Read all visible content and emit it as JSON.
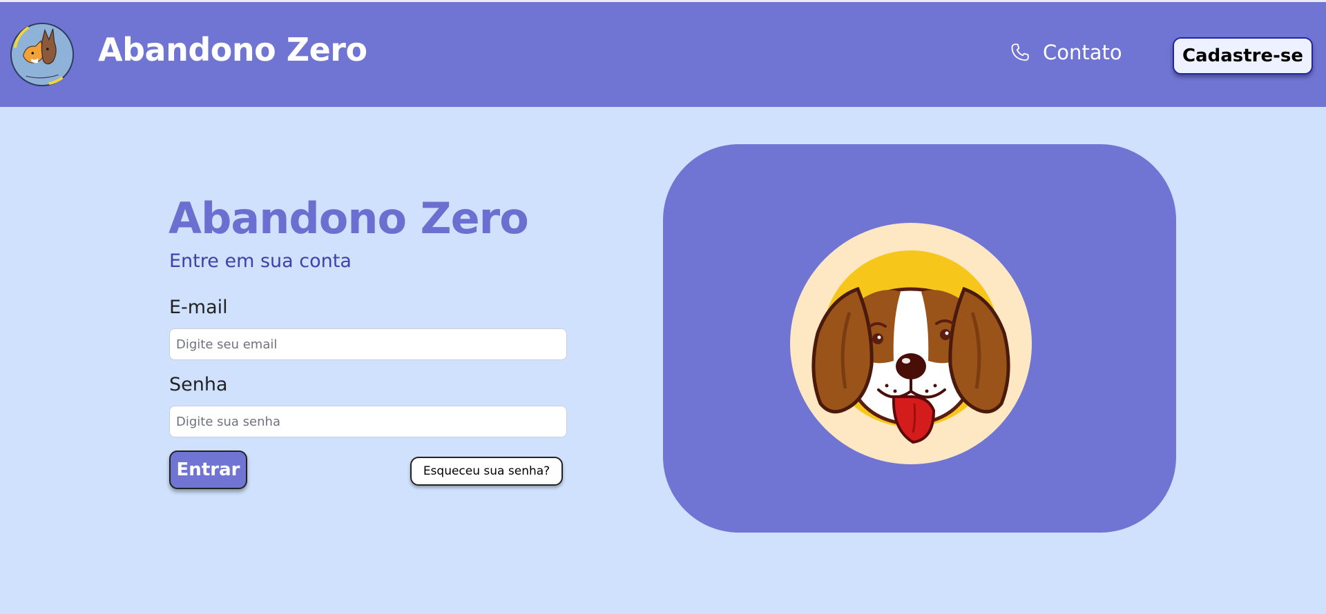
{
  "header": {
    "brand": "Abandono Zero",
    "logo_icon": "project-logo-icon",
    "contact": {
      "icon": "phone-icon",
      "label": "Contato"
    },
    "signup_label": "Cadastre-se"
  },
  "login": {
    "title": "Abandono Zero",
    "subtitle": "Entre em sua conta",
    "email": {
      "label": "E-mail",
      "placeholder": "Digite seu email",
      "value": ""
    },
    "password": {
      "label": "Senha",
      "placeholder": "Digite sua senha",
      "value": ""
    },
    "submit_label": "Entrar",
    "forgot_label": "Esqueceu sua senha?"
  },
  "illustration": {
    "icon": "dog-face-icon"
  },
  "colors": {
    "primary": "#7075d3",
    "background": "#cfe1fc",
    "subtitle": "#3c43a8",
    "signup_border": "#1f27a8"
  }
}
